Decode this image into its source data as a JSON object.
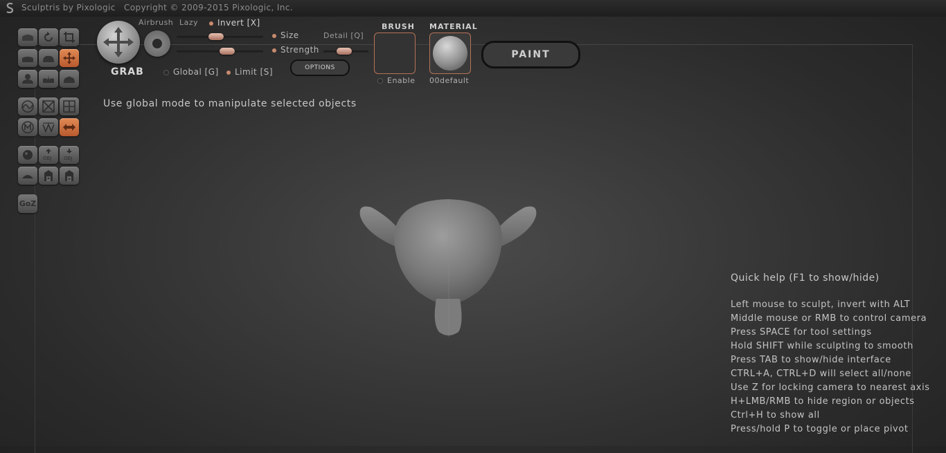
{
  "app": {
    "title": "Sculptris by Pixologic",
    "copyright": "Copyright © 2009-2015 Pixologic, Inc."
  },
  "toolbar": {
    "buttons": [
      {
        "icon": "draw-icon",
        "active": false
      },
      {
        "icon": "rotate-icon",
        "active": false
      },
      {
        "icon": "scale-icon",
        "active": false
      },
      {
        "icon": "flatten-icon",
        "active": false
      },
      {
        "icon": "inflate-icon",
        "active": false
      },
      {
        "icon": "grab-move-icon",
        "active": true
      },
      {
        "icon": "pinch-icon",
        "active": false
      },
      {
        "icon": "crease-icon",
        "active": false
      },
      {
        "icon": "smooth-icon",
        "active": false
      },
      {
        "icon": "symmetry-icon",
        "active": false
      },
      {
        "icon": "wireframe-icon",
        "active": false
      },
      {
        "icon": "grid-icon",
        "active": false
      },
      {
        "icon": "mask-icon",
        "active": false
      },
      {
        "icon": "reduce-icon",
        "active": false
      },
      {
        "icon": "mirror-icon",
        "active": true
      },
      {
        "icon": "sphere-icon",
        "active": false
      },
      {
        "icon": "import-obj-icon",
        "active": false
      },
      {
        "icon": "export-obj-icon",
        "active": false
      },
      {
        "icon": "plane-icon",
        "active": false
      },
      {
        "icon": "save-icon",
        "active": false
      },
      {
        "icon": "open-icon",
        "active": false
      }
    ],
    "goz_label": "GoZ"
  },
  "tool": {
    "name": "GRAB",
    "airbrush_label": "Airbrush",
    "lazy_label": "Lazy",
    "invert_label": "Invert [X]",
    "size_label": "Size",
    "strength_label": "Strength",
    "detail_label": "Detail [Q]",
    "global_label": "Global [G]",
    "limit_label": "Limit [S]",
    "options_label": "OPTIONS",
    "size_value": 0.45,
    "strength_value": 0.6,
    "detail_value": 0.45
  },
  "brush": {
    "header": "BRUSH",
    "enable_label": "Enable"
  },
  "material": {
    "header": "MATERIAL",
    "name": "00default"
  },
  "paint_label": "PAINT",
  "hint": "Use global mode to manipulate selected objects",
  "quick_help": {
    "title": "Quick help (F1 to show/hide)",
    "lines": [
      "Left mouse to sculpt, invert with ALT",
      "Middle mouse or RMB to control camera",
      "Press SPACE for tool settings",
      "Hold SHIFT while sculpting to smooth",
      "Press TAB to show/hide interface",
      "CTRL+A, CTRL+D will select all/none",
      "Use Z for locking camera to nearest axis",
      "H+LMB/RMB to hide region or objects",
      "Ctrl+H to show all",
      "Press/hold P to toggle or place pivot"
    ]
  },
  "colors": {
    "accent": "#c8693c",
    "slider_knob": "#d7a896",
    "background": "#333333"
  }
}
